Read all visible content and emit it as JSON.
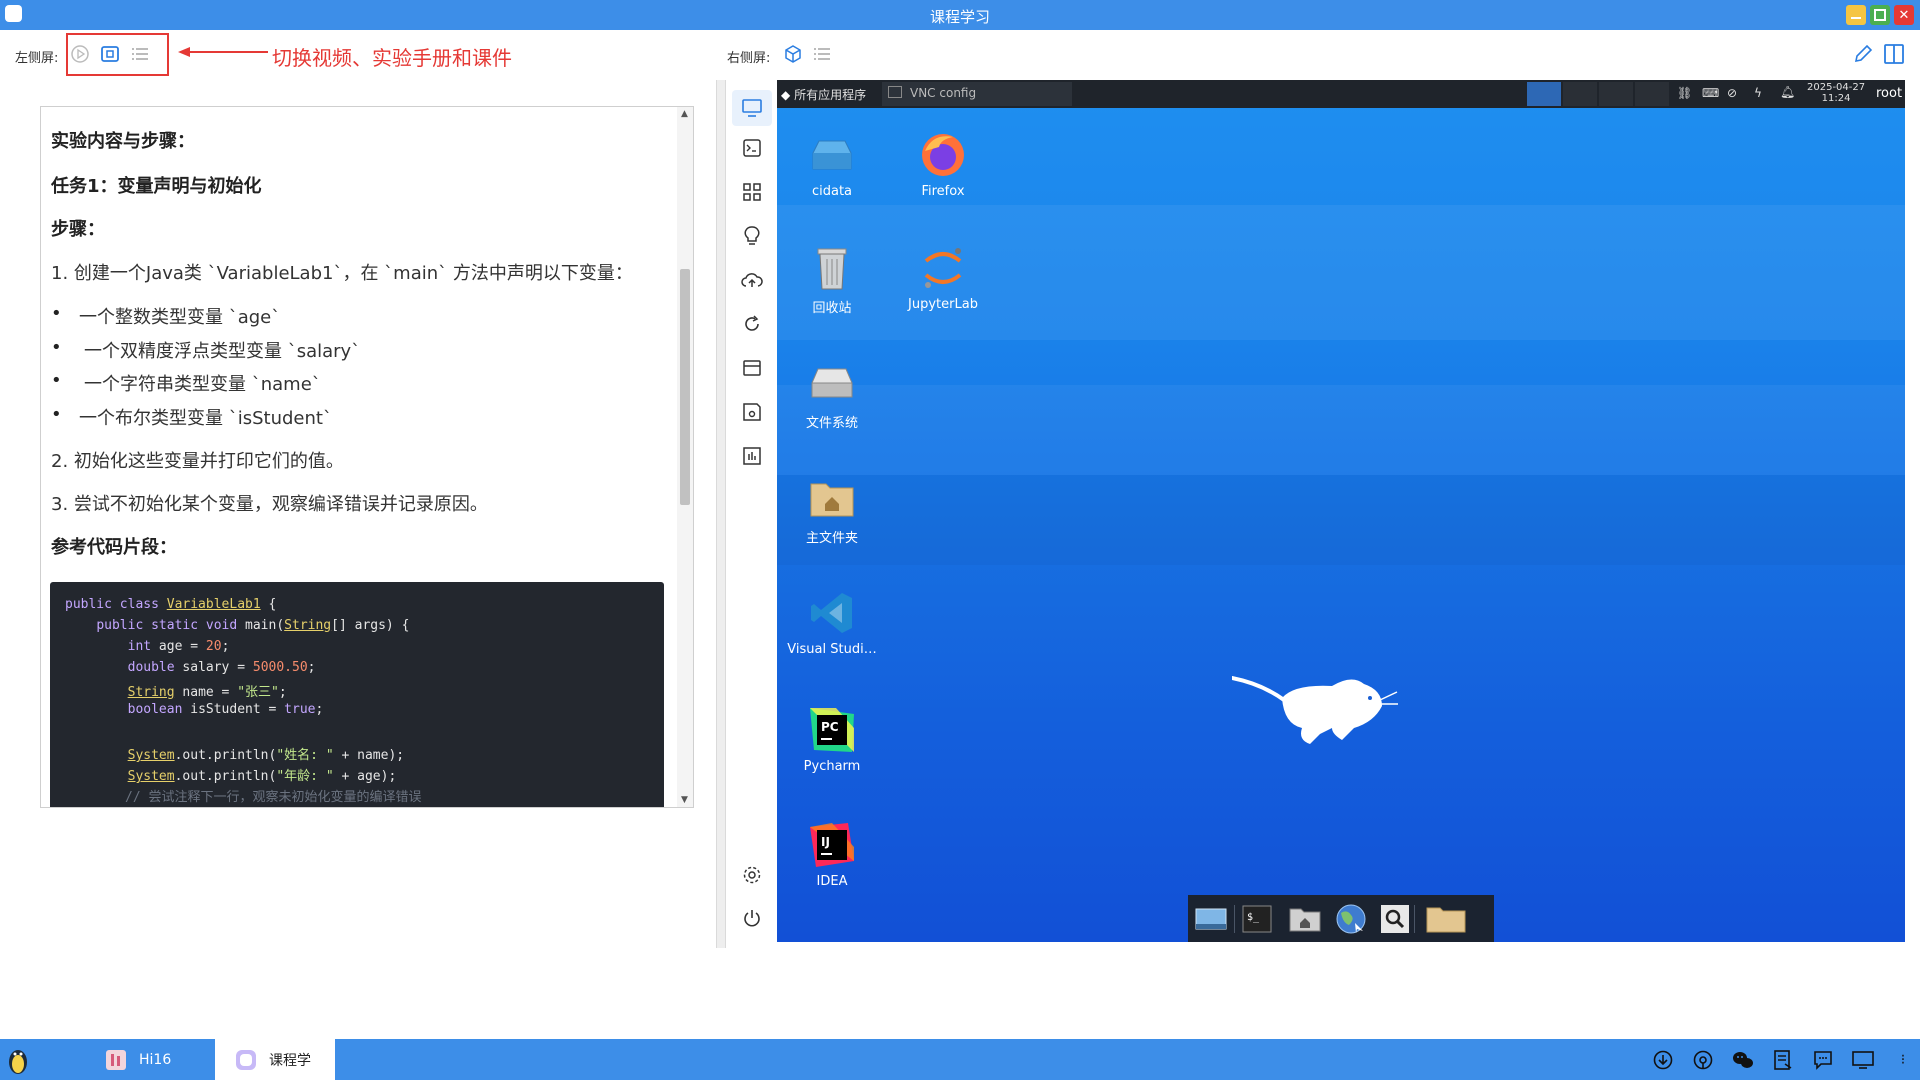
{
  "window": {
    "title": "课程学习"
  },
  "toolbar": {
    "left_label": "左侧屏:",
    "right_label": "右侧屏:",
    "icons": [
      "play-icon",
      "lab-manual-icon",
      "list-icon",
      "cube-icon",
      "list-icon",
      "edit-icon",
      "split-view-icon"
    ]
  },
  "annotation": {
    "text": "切换视频、实验手册和课件"
  },
  "doc": {
    "h1": "实验内容与步骤：",
    "task": "任务1：变量声明与初始化",
    "steps_title": "步骤：",
    "step1": "1. 创建一个Java类 `VariableLab1`，在 `main` 方法中声明以下变量：",
    "bullets": [
      "一个整数类型变量 `age`",
      "一个双精度浮点类型变量 `salary`",
      "一个字符串类型变量 `name`",
      "一个布尔类型变量 `isStudent`"
    ],
    "step2": "2. 初始化这些变量并打印它们的值。",
    "step3": "3. 尝试不初始化某个变量，观察编译错误并记录原因。",
    "ref_title": "参考代码片段：",
    "code_comment": "// 尝试注释下一行，观察未初始化变量的编译错误"
  },
  "remote": {
    "topbar": {
      "apps_menu": "所有应用程序",
      "window_tab": "VNC config",
      "date": "2025-04-27",
      "time": "11:24",
      "user": "root"
    },
    "icons": {
      "cidata": "cidata",
      "firefox": "Firefox",
      "trash": "回收站",
      "jupyter": "JupyterLab",
      "filesystem": "文件系统",
      "home": "主文件夹",
      "vscode": "Visual Studi…",
      "pycharm": "Pycharm",
      "idea": "IDEA"
    }
  },
  "taskbar": {
    "item1": "Hi16",
    "item2": "课程学"
  },
  "colors": {
    "titlebar": "#3d8ee8",
    "annotation": "#e53935",
    "desktop": "#1565d8",
    "code_bg": "#23272e"
  }
}
